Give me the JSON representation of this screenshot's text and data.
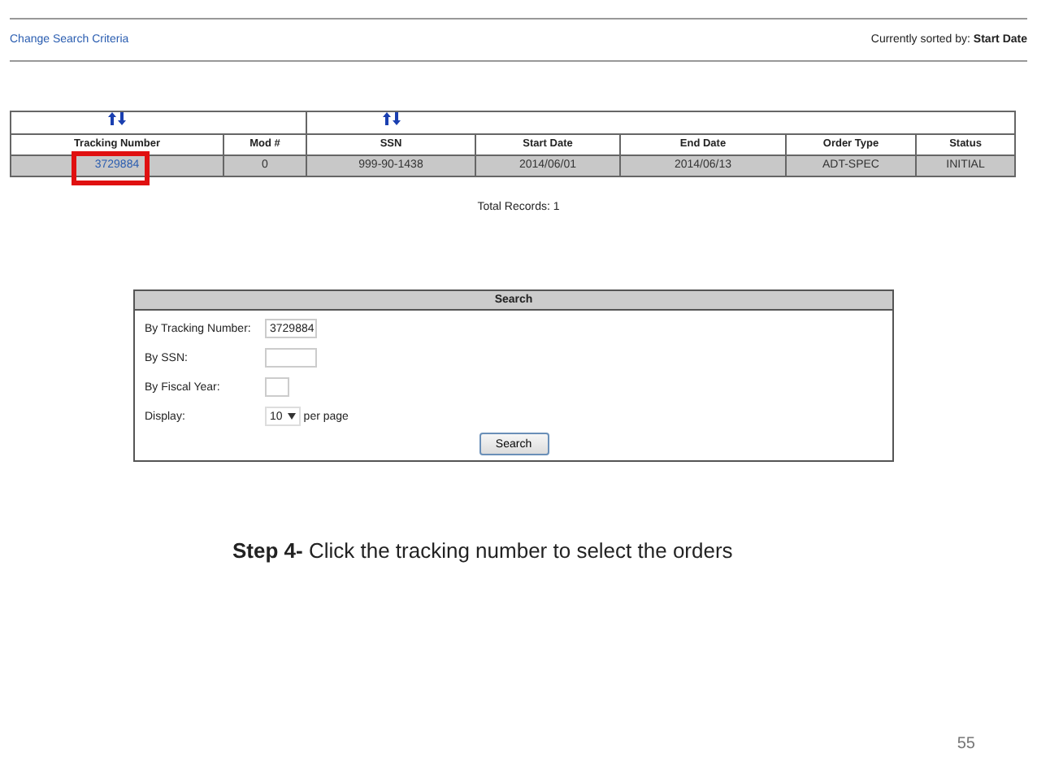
{
  "nav": {
    "link": "Change Search Criteria",
    "sorted_by": "Currently sorted by: **Start Date**"
  },
  "table": {
    "columns": [
      {
        "label": "Tracking Number",
        "sort_icon": true
      },
      {
        "label": "Mod #",
        "sort_icon": false
      },
      {
        "label": "SSN",
        "sort_icon": true
      },
      {
        "label": "Start Date",
        "sort_icon": false
      },
      {
        "label": "End Date",
        "sort_icon": false
      },
      {
        "label": "Order Type",
        "sort_icon": false
      },
      {
        "label": "Status",
        "sort_icon": false
      }
    ],
    "rows": [
      {
        "cells": [
          {
            "kind": "link",
            "text": "3729884",
            "highlighted": true
          },
          {
            "kind": "plain",
            "text": "0",
            "highlighted": false
          },
          {
            "kind": "plain",
            "text": "999-90-1438",
            "highlighted": false
          },
          {
            "kind": "plain",
            "text": "2014/06/01",
            "highlighted": false
          },
          {
            "kind": "plain",
            "text": "2014/06/13",
            "highlighted": false
          },
          {
            "kind": "plain",
            "text": "ADT-SPEC",
            "highlighted": false
          },
          {
            "kind": "plain",
            "text": "INITIAL",
            "highlighted": false
          }
        ]
      }
    ],
    "total": "Total Records: 1"
  },
  "search": {
    "title": "Search",
    "fields": [
      {
        "kind": "text",
        "label": "By Tracking Number:",
        "value": "3729884"
      },
      {
        "kind": "text",
        "label": "By SSN:"
      },
      {
        "kind": "year",
        "label": "By Fiscal Year:"
      },
      {
        "kind": "select",
        "label": "Display:",
        "value": "10",
        "suffix": "per page"
      }
    ],
    "button": "Search"
  },
  "caption": "**Step 4-** Click the tracking number to select the orders",
  "page_number": "55"
}
